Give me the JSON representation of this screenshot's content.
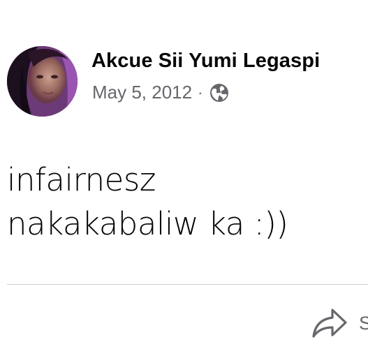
{
  "post": {
    "author": "Akcue Sii Yumi Legaspi",
    "date": "May 5, 2012",
    "separator": "·",
    "audience_icon": "globe-icon",
    "body_lines": [
      "infairnesz",
      "nakakabaliw ka :))"
    ]
  },
  "actions": {
    "share_label": "S",
    "share_icon": "share-arrow-icon"
  },
  "colors": {
    "name_text": "#050505",
    "meta_text": "#65676b",
    "divider": "#ced0d4",
    "avatar_ring": "#a261b8"
  }
}
